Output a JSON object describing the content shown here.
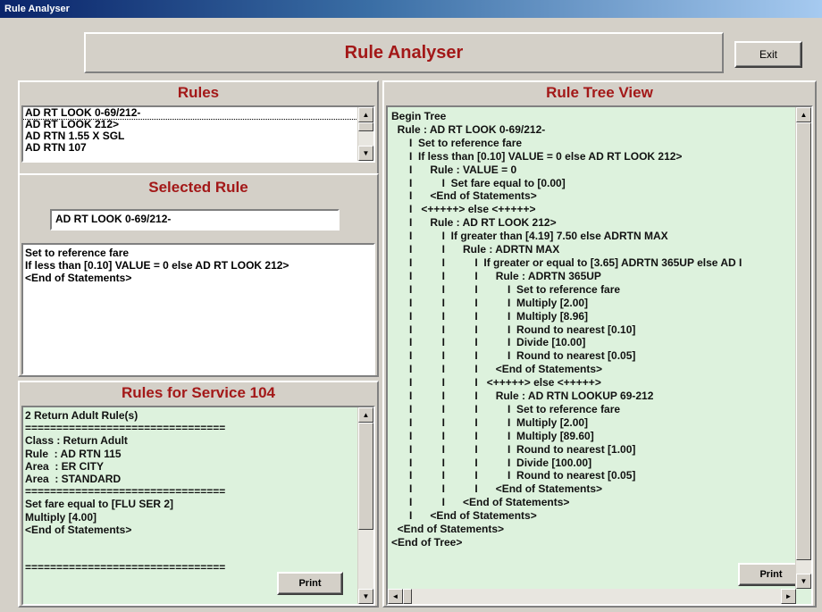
{
  "window": {
    "title": "Rule Analyser"
  },
  "banner": {
    "title": "Rule Analyser"
  },
  "exit_label": "Exit",
  "rules_panel": {
    "title": "Rules",
    "items": [
      "AD RT LOOK 0-69/212-",
      "AD RT LOOK 212>",
      "AD RTN 1.55 X SGL",
      "AD RTN 107"
    ]
  },
  "selected_panel": {
    "title": "Selected Rule",
    "value": "AD RT LOOK 0-69/212-",
    "statements": [
      "Set to reference fare",
      "If less than [0.10] VALUE = 0 else AD RT LOOK 212>",
      "<End of Statements>"
    ]
  },
  "service_panel": {
    "title": "Rules for Service 104",
    "lines": [
      "2 Return Adult Rule(s)",
      "",
      "================================",
      "Class : Return Adult",
      "Rule  : AD RTN 115",
      "Area  : ER CITY",
      "Area  : STANDARD",
      "================================",
      "Set fare equal to [FLU SER 2]",
      "Multiply [4.00]",
      "<End of Statements>",
      "",
      "",
      "================================"
    ],
    "print_label": "Print"
  },
  "tree_panel": {
    "title": "Rule Tree View",
    "lines": [
      "Begin Tree",
      "  Rule : AD RT LOOK 0-69/212-",
      "      I  Set to reference fare",
      "      I  If less than [0.10] VALUE = 0 else AD RT LOOK 212>",
      "      I      Rule : VALUE = 0",
      "      I          I  Set fare equal to [0.00]",
      "      I      <End of Statements>",
      "      I   <+++++> else <+++++>",
      "      I      Rule : AD RT LOOK 212>",
      "      I          I  If greater than [4.19] 7.50 else ADRTN MAX",
      "      I          I      Rule : ADRTN MAX",
      "      I          I          I  If greater or equal to [3.65] ADRTN 365UP else AD I",
      "      I          I          I      Rule : ADRTN 365UP",
      "      I          I          I          I  Set to reference fare",
      "      I          I          I          I  Multiply [2.00]",
      "      I          I          I          I  Multiply [8.96]",
      "      I          I          I          I  Round to nearest [0.10]",
      "      I          I          I          I  Divide [10.00]",
      "      I          I          I          I  Round to nearest [0.05]",
      "      I          I          I      <End of Statements>",
      "      I          I          I   <+++++> else <+++++>",
      "      I          I          I      Rule : AD RTN LOOKUP 69-212",
      "      I          I          I          I  Set to reference fare",
      "      I          I          I          I  Multiply [2.00]",
      "      I          I          I          I  Multiply [89.60]",
      "      I          I          I          I  Round to nearest [1.00]",
      "      I          I          I          I  Divide [100.00]",
      "      I          I          I          I  Round to nearest [0.05]",
      "      I          I          I      <End of Statements>",
      "      I          I      <End of Statements>",
      "      I      <End of Statements>",
      "  <End of Statements>",
      "<End of Tree>"
    ],
    "print_label": "Print"
  }
}
